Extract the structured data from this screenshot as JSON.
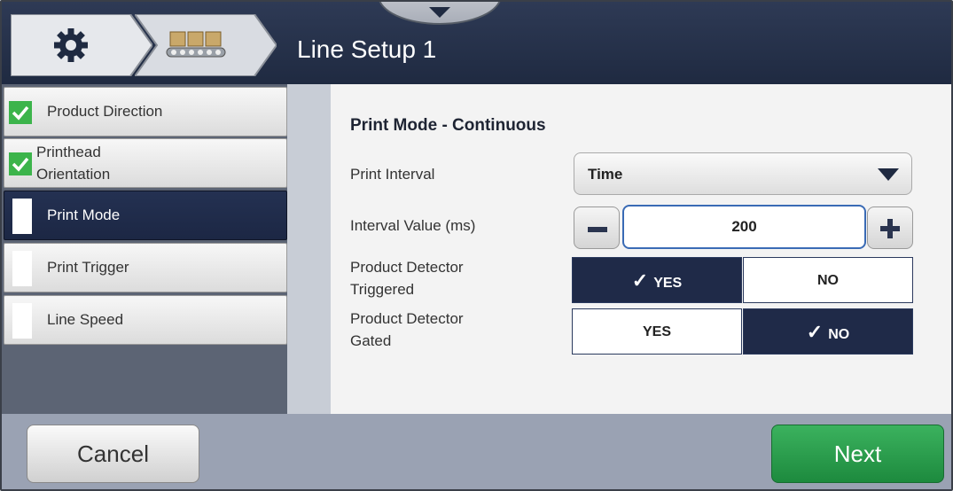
{
  "header": {
    "title": "Line Setup 1",
    "crumbs": [
      {
        "icon": "gear-icon"
      },
      {
        "icon": "conveyor-icon"
      }
    ],
    "top_tab_icon": "chevron-down-icon"
  },
  "nav": {
    "items": [
      {
        "label": "Product Direction",
        "status": "complete"
      },
      {
        "label": "Printhead\nOrientation",
        "label_line1": "Printhead",
        "label_line2": "Orientation",
        "status": "complete"
      },
      {
        "label": "Print Mode",
        "status": "active"
      },
      {
        "label": "Print Trigger",
        "status": "pending"
      },
      {
        "label": "Line Speed",
        "status": "pending"
      }
    ]
  },
  "panel": {
    "title": "Print Mode - Continuous",
    "print_interval": {
      "label": "Print Interval",
      "value": "Time"
    },
    "interval_value": {
      "label": "Interval Value (ms)",
      "value": "200"
    },
    "product_detector_triggered": {
      "label_line1": "Product Detector",
      "label_line2": "Triggered",
      "yes_label": "YES",
      "no_label": "NO",
      "selected": "YES"
    },
    "product_detector_gated": {
      "label_line1": "Product Detector",
      "label_line2": "Gated",
      "yes_label": "YES",
      "no_label": "NO",
      "selected": "NO"
    }
  },
  "footer": {
    "cancel_label": "Cancel",
    "next_label": "Next"
  },
  "colors": {
    "header": "#1f2a41",
    "active_nav": "#1f2a48",
    "check_green": "#3cb44b",
    "next_green": "#2aa04f"
  }
}
